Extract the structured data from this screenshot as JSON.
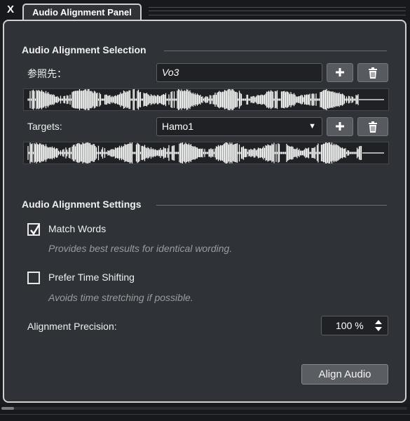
{
  "window": {
    "close_label": "X",
    "tab_title": "Audio Alignment Panel"
  },
  "selection": {
    "title": "Audio Alignment Selection",
    "reference_label": "参照先：",
    "reference_value": "Vo3",
    "targets_label": "Targets:",
    "targets_value": "Hamo1",
    "add_icon": "plus-icon",
    "delete_icon": "trash-icon",
    "dropdown_icon": "▼"
  },
  "settings": {
    "title": "Audio Alignment Settings",
    "match_words": {
      "label": "Match Words",
      "checked": true,
      "hint": "Provides best results for identical wording."
    },
    "prefer_time_shifting": {
      "label": "Prefer Time Shifting",
      "checked": false,
      "hint": "Avoids time stretching if possible."
    },
    "precision_label": "Alignment Precision:",
    "precision_value": "100 %"
  },
  "actions": {
    "align_label": "Align Audio"
  },
  "colors": {
    "panel_bg": "#2f3236",
    "field_bg": "#1f2124",
    "waveform": "#ffffff"
  }
}
